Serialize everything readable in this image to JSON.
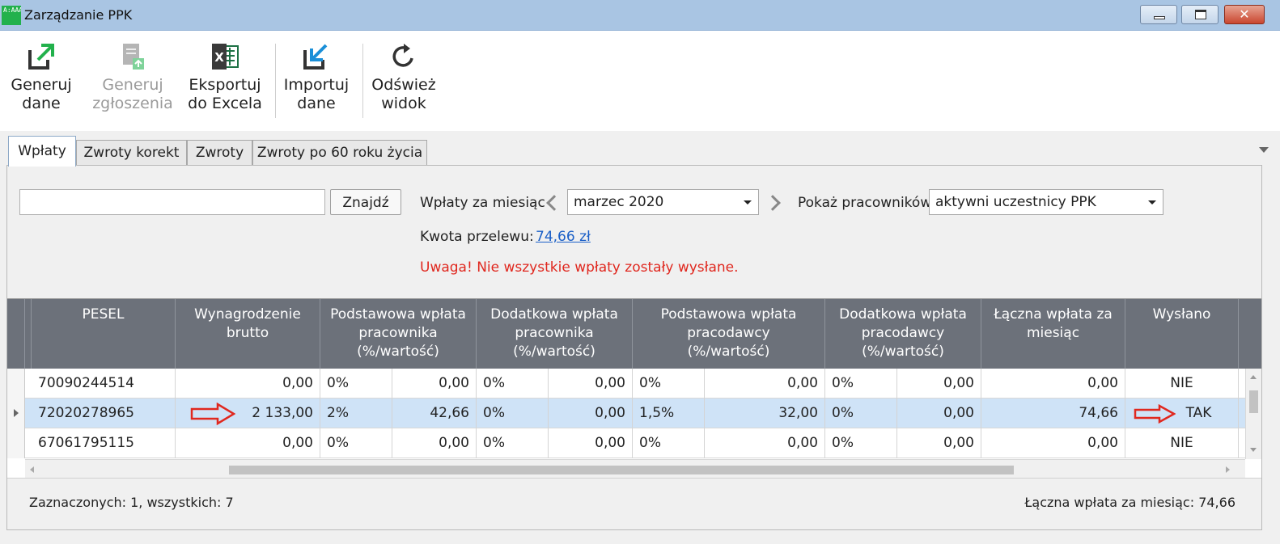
{
  "window": {
    "title": "Zarządzanie PPK",
    "app_icon_text": "A:AAA"
  },
  "ribbon": {
    "generate_data": "Generuj\ndane",
    "generate_data_l1": "Generuj",
    "generate_data_l2": "dane",
    "generate_reports_l1": "Generuj",
    "generate_reports_l2": "zgłoszenia",
    "export_excel_l1": "Eksportuj",
    "export_excel_l2": "do Excela",
    "import_l1": "Importuj",
    "import_l2": "dane",
    "refresh_l1": "Odśwież",
    "refresh_l2": "widok"
  },
  "tabs": [
    {
      "label": "Wpłaty"
    },
    {
      "label": "Zwroty korekt"
    },
    {
      "label": "Zwroty"
    },
    {
      "label": "Zwroty po 60 roku życia"
    }
  ],
  "filters": {
    "search_value": "",
    "find_label": "Znajdź",
    "month_label": "Wpłaty za miesiąc",
    "month_value": "marzec 2020",
    "show_label": "Pokaż pracowników",
    "show_value": "aktywni uczestnicy PPK",
    "transfer_label": "Kwota przelewu:",
    "transfer_value": "74,66 zł",
    "warning": "Uwaga! Nie wszystkie wpłaty zostały wysłane."
  },
  "grid": {
    "headers": {
      "pesel": "PESEL",
      "gross_l1": "Wynagrodzenie",
      "gross_l2": "brutto",
      "emp_basic_l1": "Podstawowa wpłata",
      "emp_basic_l2": "pracownika",
      "emp_basic_l3": "(%/wartość)",
      "emp_extra_l1": "Dodatkowa wpłata",
      "emp_extra_l2": "pracownika",
      "emp_extra_l3": "(%/wartość)",
      "er_basic_l1": "Podstawowa wpłata",
      "er_basic_l2": "pracodawcy",
      "er_basic_l3": "(%/wartość)",
      "er_extra_l1": "Dodatkowa wpłata",
      "er_extra_l2": "pracodawcy",
      "er_extra_l3": "(%/wartość)",
      "total_l1": "Łączna wpłata za",
      "total_l2": "miesiąc",
      "sent": "Wysłano"
    },
    "rows": [
      {
        "pesel": "70090244514",
        "gross": "0,00",
        "eb_pct": "0%",
        "eb_val": "0,00",
        "ee_pct": "0%",
        "ee_val": "0,00",
        "rb_pct": "0%",
        "rb_val": "0,00",
        "re_pct": "0%",
        "re_val": "0,00",
        "total": "0,00",
        "sent": "NIE"
      },
      {
        "pesel": "72020278965",
        "gross": "2 133,00",
        "eb_pct": "2%",
        "eb_val": "42,66",
        "ee_pct": "0%",
        "ee_val": "0,00",
        "rb_pct": "1,5%",
        "rb_val": "32,00",
        "re_pct": "0%",
        "re_val": "0,00",
        "total": "74,66",
        "sent": "TAK"
      },
      {
        "pesel": "67061795115",
        "gross": "0,00",
        "eb_pct": "0%",
        "eb_val": "0,00",
        "ee_pct": "0%",
        "ee_val": "0,00",
        "rb_pct": "0%",
        "rb_val": "0,00",
        "re_pct": "0%",
        "re_val": "0,00",
        "total": "0,00",
        "sent": "NIE"
      }
    ]
  },
  "status": {
    "selection": "Zaznaczonych: 1, wszystkich: 7",
    "total": "Łączna wpłata za miesiąc: 74,66"
  },
  "colors": {
    "accent_green": "#22b14c",
    "accent_blue": "#1a8fd8",
    "warning_red": "#e0281f",
    "header_bg": "#6c717a",
    "selected_row": "#cfe3f7"
  }
}
